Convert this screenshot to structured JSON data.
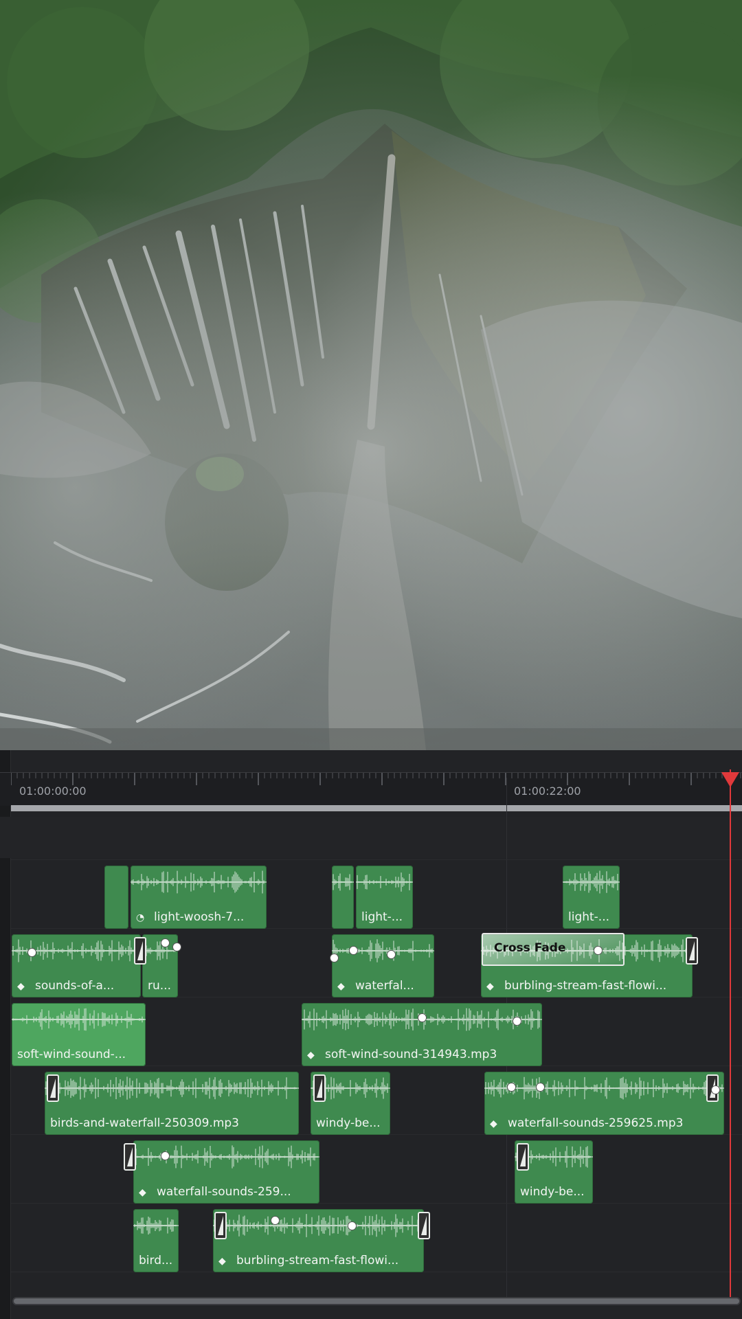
{
  "timeline": {
    "timecode_start": "01:00:00:00",
    "timecode_mid": "01:00:22:00",
    "crossfade_label": "Cross Fade",
    "clips": [
      {
        "label": "light-woosh-7...",
        "icon": "speedometer-icon"
      },
      {
        "label": "light-...",
        "icon": ""
      },
      {
        "label": "light-...",
        "icon": ""
      },
      {
        "label": "sounds-of-a...",
        "icon": "keyframe-diamond-icon"
      },
      {
        "label": "ru...",
        "icon": ""
      },
      {
        "label": "waterfal...",
        "icon": "keyframe-diamond-icon"
      },
      {
        "label": "burbling-stream-fast-flowi...",
        "icon": "keyframe-diamond-icon"
      },
      {
        "label": "soft-wind-sound-...",
        "icon": ""
      },
      {
        "label": "soft-wind-sound-314943.mp3",
        "icon": "keyframe-diamond-icon"
      },
      {
        "label": "birds-and-waterfall-250309.mp3",
        "icon": ""
      },
      {
        "label": "windy-be...",
        "icon": ""
      },
      {
        "label": "waterfall-sounds-259625.mp3",
        "icon": "keyframe-diamond-icon"
      },
      {
        "label": "waterfall-sounds-259...",
        "icon": "keyframe-diamond-icon"
      },
      {
        "label": "windy-be...",
        "icon": ""
      },
      {
        "label": "bird...",
        "icon": ""
      },
      {
        "label": "burbling-stream-fast-flowi...",
        "icon": "keyframe-diamond-icon"
      }
    ]
  },
  "colors": {
    "clip_green": "#3f8a4f",
    "clip_selected": "#4ea65f",
    "playhead": "#e0393b",
    "panel": "#222326"
  }
}
